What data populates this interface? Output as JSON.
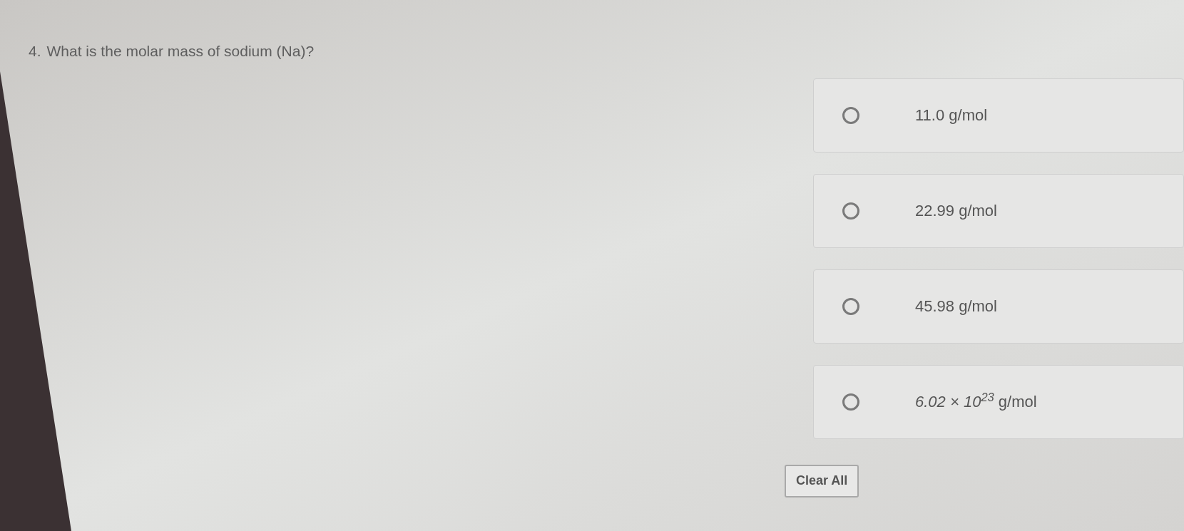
{
  "question": {
    "number": "4.",
    "text": "What is the molar mass of sodium (Na)?"
  },
  "options": [
    {
      "label": "11.0 g/mol",
      "selected": false
    },
    {
      "label": "22.99 g/mol",
      "selected": false
    },
    {
      "label": "45.98 g/mol",
      "selected": false
    },
    {
      "label": "*6.02 × 10$^{23}$* g/mol",
      "selected": false
    }
  ],
  "clear_button": {
    "label": "Clear All"
  }
}
